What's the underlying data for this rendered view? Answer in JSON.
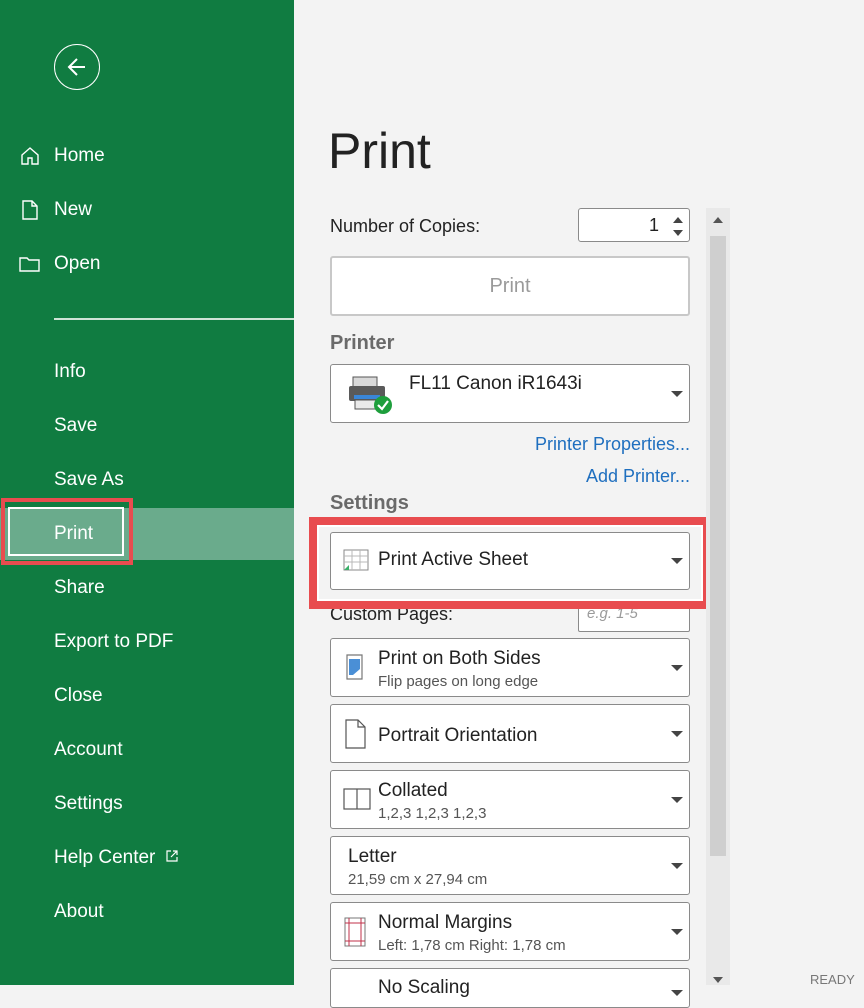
{
  "sidebar": {
    "top_items": [
      {
        "label": "Home",
        "icon": "home-icon"
      },
      {
        "label": "New",
        "icon": "new-document-icon"
      },
      {
        "label": "Open",
        "icon": "folder-icon"
      }
    ],
    "items": [
      {
        "label": "Info"
      },
      {
        "label": "Save"
      },
      {
        "label": "Save As"
      },
      {
        "label": "Print"
      },
      {
        "label": "Share"
      },
      {
        "label": "Export to PDF"
      },
      {
        "label": "Close"
      },
      {
        "label": "Account"
      },
      {
        "label": "Settings"
      },
      {
        "label": "Help Center",
        "icon": "external-link-icon"
      },
      {
        "label": "About"
      }
    ],
    "active": "Print"
  },
  "main": {
    "title": "Print",
    "copies_label": "Number of Copies:",
    "copies_value": "1",
    "print_button": "Print",
    "printer_header": "Printer",
    "printer_name": "FL11 Canon iR1643i",
    "printer_properties": "Printer Properties...",
    "add_printer": "Add Printer...",
    "settings_header": "Settings",
    "what_to_print": "Print Active Sheet",
    "custom_pages_label": "Custom Pages:",
    "custom_pages_placeholder": "e.g. 1-5",
    "duplex_title": "Print on Both Sides",
    "duplex_sub": "Flip pages on long edge",
    "orientation": "Portrait Orientation",
    "collation_title": "Collated",
    "collation_sub": "1,2,3 1,2,3 1,2,3",
    "paper_title": "Letter",
    "paper_sub": "21,59 cm x 27,94 cm",
    "margins_title": "Normal Margins",
    "margins_sub": "Left: 1,78 cm  Right: 1,78 cm",
    "scaling_partial": "No Scaling"
  },
  "status": {
    "text": "READY"
  },
  "colors": {
    "accent": "#107c41",
    "highlight": "#e84c4f",
    "link": "#1f6fbf",
    "active_bg": "#6aab8c"
  }
}
